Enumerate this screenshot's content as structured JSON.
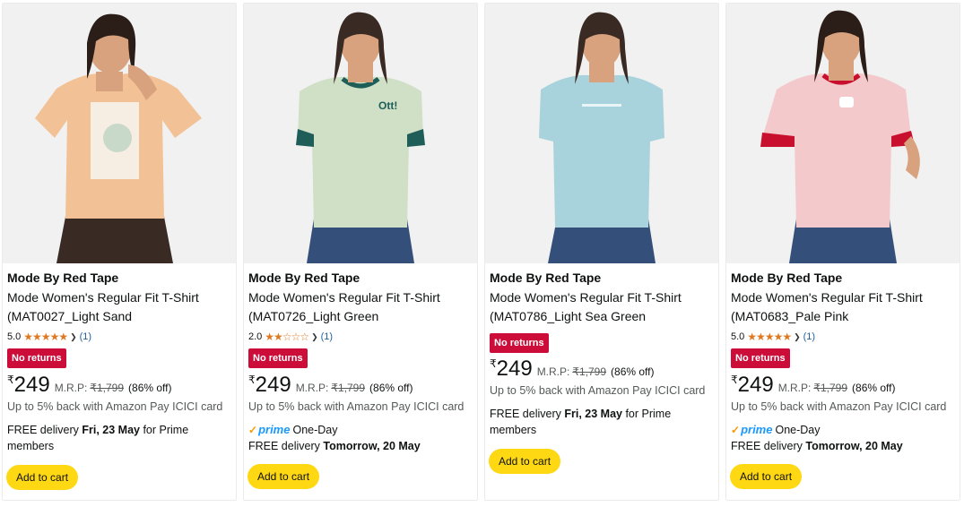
{
  "products": [
    {
      "brand": "Mode By Red Tape",
      "title_line1": "Mode Women's Regular Fit T-Shirt",
      "title_line2": "(MAT0027_Light Sand",
      "rating": "5.0",
      "stars": "★★★★★",
      "rating_count": "(1)",
      "badge": "No returns",
      "currency": "₹",
      "price": "249",
      "mrp_label": "M.R.P:",
      "mrp": "₹1,799",
      "discount": "(86% off)",
      "offer": "Up to 5% back with Amazon Pay ICICI card",
      "prime_logo": "",
      "prime_text": "",
      "delivery_prefix": "FREE delivery ",
      "delivery_date": "Fri, 23 May",
      "delivery_suffix": " for Prime members",
      "cart_label": "Add to cart",
      "shirt_color": "#f2c195",
      "trim_color": "#f2c195"
    },
    {
      "brand": "Mode By Red Tape",
      "title_line1": "Mode Women's Regular Fit T-Shirt",
      "title_line2": "(MAT0726_Light Green",
      "rating": "2.0",
      "stars": "★★☆☆☆",
      "rating_count": "(1)",
      "badge": "No returns",
      "currency": "₹",
      "price": "249",
      "mrp_label": "M.R.P:",
      "mrp": "₹1,799",
      "discount": "(86% off)",
      "offer": "Up to 5% back with Amazon Pay ICICI card",
      "prime_logo": "prime",
      "prime_text": "One-Day",
      "delivery_prefix": "FREE delivery ",
      "delivery_date": "Tomorrow, 20 May",
      "delivery_suffix": "",
      "cart_label": "Add to cart",
      "shirt_color": "#cfe0c6",
      "trim_color": "#1f5d58"
    },
    {
      "brand": "Mode By Red Tape",
      "title_line1": "Mode Women's Regular Fit T-Shirt",
      "title_line2": "(MAT0786_Light Sea Green",
      "rating": "",
      "stars": "",
      "rating_count": "",
      "badge": "No returns",
      "currency": "₹",
      "price": "249",
      "mrp_label": "M.R.P:",
      "mrp": "₹1,799",
      "discount": "(86% off)",
      "offer": "Up to 5% back with Amazon Pay ICICI card",
      "prime_logo": "",
      "prime_text": "",
      "delivery_prefix": "FREE delivery ",
      "delivery_date": "Fri, 23 May",
      "delivery_suffix": " for Prime members",
      "cart_label": "Add to cart",
      "shirt_color": "#a9d3dc",
      "trim_color": "#a9d3dc"
    },
    {
      "brand": "Mode By Red Tape",
      "title_line1": "Mode Women's Regular Fit T-Shirt",
      "title_line2": "(MAT0683_Pale Pink",
      "rating": "5.0",
      "stars": "★★★★★",
      "rating_count": "(1)",
      "badge": "No returns",
      "currency": "₹",
      "price": "249",
      "mrp_label": "M.R.P:",
      "mrp": "₹1,799",
      "discount": "(86% off)",
      "offer": "Up to 5% back with Amazon Pay ICICI card",
      "prime_logo": "prime",
      "prime_text": "One-Day",
      "delivery_prefix": "FREE delivery ",
      "delivery_date": "Tomorrow, 20 May",
      "delivery_suffix": "",
      "cart_label": "Add to cart",
      "shirt_color": "#f4c9cc",
      "trim_color": "#c8102e"
    }
  ],
  "colors": {
    "accent_badge": "#cc0c39",
    "cart_button": "#ffd814",
    "star": "#de7921",
    "prime": "#1a98ff",
    "link": "#2162a1"
  },
  "icons": {
    "star": "star-icon",
    "chevron": "chevron-down-icon",
    "prime_check": "prime-check-icon"
  }
}
